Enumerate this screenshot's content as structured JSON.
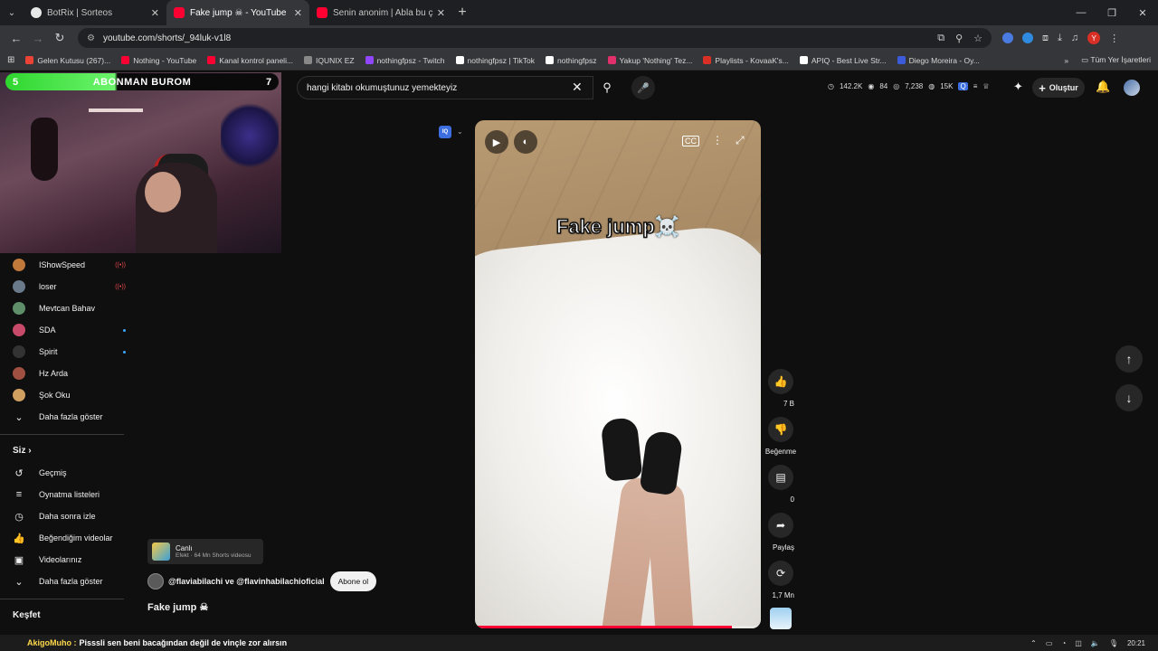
{
  "browser": {
    "tabs": [
      {
        "title": "BotRix | Sorteos",
        "fav": "bot"
      },
      {
        "title": "Fake jump ☠ - YouTube",
        "fav": "yt",
        "active": true
      },
      {
        "title": "Senin anonim | Abla bu çok kü",
        "fav": "yt"
      }
    ],
    "url": "youtube.com/shorts/_94luk-v1l8",
    "bookmarks": [
      {
        "label": "Gelen Kutusu (267)...",
        "color": "#ea4335"
      },
      {
        "label": "Nothing - YouTube",
        "color": "#ff0033"
      },
      {
        "label": "Kanal kontrol paneli...",
        "color": "#ff0033"
      },
      {
        "label": "IQUNIX EZ",
        "color": "#888888"
      },
      {
        "label": "nothingfpsz - Twitch",
        "color": "#9146ff"
      },
      {
        "label": "nothingfpsz | TikTok",
        "color": "#ffffff"
      },
      {
        "label": "nothingfpsz",
        "color": "#ffffff"
      },
      {
        "label": "Yakup 'Nothing' Tez...",
        "color": "#e1306c"
      },
      {
        "label": "Playlists - KovaaK's...",
        "color": "#d93025"
      },
      {
        "label": "APIQ - Best Live Str...",
        "color": "#ffffff"
      },
      {
        "label": "Diego Moreira - Oy...",
        "color": "#3b5bdb"
      }
    ],
    "bookmarks_all": "Tüm Yer İşaretleri"
  },
  "header": {
    "search_query": "hangi kitabı okumuştunuz yemekteyiz",
    "stats": [
      "142.2K",
      "84",
      "7,238",
      "15K"
    ],
    "create_label": "Oluştur"
  },
  "webcam": {
    "bar_left": "5",
    "bar_text": "ABONMAN BUROM",
    "bar_right": "7"
  },
  "sidebar": {
    "subscriptions": [
      {
        "name": "IShowSpeed",
        "live": true,
        "color": "#c0793a"
      },
      {
        "name": "loser",
        "live": true,
        "color": "#6b7a8a"
      },
      {
        "name": "Mevtcan Bahav",
        "live": false,
        "color": "#5f8f6a"
      },
      {
        "name": "SDA",
        "dot": true,
        "color": "#c84a6a"
      },
      {
        "name": "Spirit",
        "dot": true,
        "color": "#333333"
      },
      {
        "name": "Hz Arda",
        "live": false,
        "color": "#a05040"
      },
      {
        "name": "Şok Oku",
        "live": false,
        "color": "#d0a060"
      }
    ],
    "show_more": "Daha fazla göster",
    "you_heading": "Siz",
    "you_items": [
      {
        "label": "Geçmiş",
        "icon": "history-icon",
        "glyph": "↺"
      },
      {
        "label": "Oynatma listeleri",
        "icon": "playlist-icon",
        "glyph": "≡"
      },
      {
        "label": "Daha sonra izle",
        "icon": "clock-icon",
        "glyph": "◷"
      },
      {
        "label": "Beğendiğim videolar",
        "icon": "thumbs-up-icon",
        "glyph": "👍"
      },
      {
        "label": "Videolarınız",
        "icon": "video-icon",
        "glyph": "▣"
      }
    ],
    "show_more_2": "Daha fazla göster",
    "explore_heading": "Keşfet"
  },
  "video": {
    "overlay_title": "Fake jump☠️",
    "progress": 0.9
  },
  "actions": {
    "likes": "7 B",
    "dislike_label": "Beğenme",
    "comments": "0",
    "share_label": "Paylaş",
    "remix_count": "1,7 Mn"
  },
  "info": {
    "effect_title": "Canlı",
    "effect_sub": "Efekt · 64 Mn Shorts videosu",
    "channel": "@flaviabilachi ve @flavinhabilachioficial",
    "subscribe": "Abone ol",
    "title": "Fake jump ☠"
  },
  "chat": {
    "name": "AkigoMuho :",
    "message": "Pisssli sen beni bacağından değil de vinçle zor alırsın"
  },
  "taskbar": {
    "time": "20:21"
  }
}
